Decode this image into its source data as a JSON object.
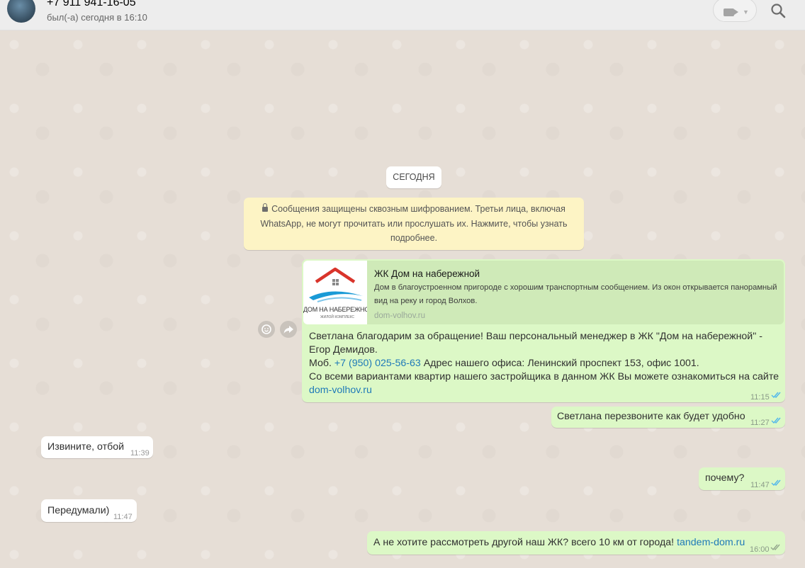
{
  "header": {
    "contact_name": "+7 911 941-16-05",
    "status": "был(-а) сегодня в 16:10",
    "icons": [
      "avatar",
      "video-call-icon",
      "chevron-down-icon",
      "search-icon"
    ]
  },
  "chat": {
    "date_label": "СЕГОДНЯ",
    "encryption_notice": "Сообщения защищены сквозным шифрованием. Третьи лица, включая WhatsApp, не могут прочитать или прослушать их. Нажмите, чтобы узнать подробнее.",
    "link_preview": {
      "title": "ЖК Дом на набережной",
      "description": "Дом в благоустроенном пригороде с хорошим транспортным сообщением. Из окон открывается панорамный вид на реку  и город Волхов.",
      "url": "dom-volhov.ru",
      "thumb_text": "ДОМ НА НАБЕРЕЖНОЙ",
      "thumb_subtext": "ЖИЛОЙ КОМПЛЕКС"
    },
    "messages": [
      {
        "direction": "out",
        "line1": "Светлана благодарим за обращение! Ваш персональный менеджер в ЖК \"Дом на набережной\" -",
        "line2": "Егор Демидов.",
        "line3_prefix": "Моб. ",
        "phone": "+7 (950) 025-56-63",
        "line3_suffix": " Адрес нашего офиса: Ленинский проспект 153, офис 1001.",
        "line4": "Со всеми вариантами квартир нашего застройщика в данном ЖК Вы можете ознакомиться на сайте",
        "link": "dom-volhov.ru",
        "time": "11:15",
        "status": "read"
      },
      {
        "direction": "out",
        "text": "Светлана перезвоните как будет удобно",
        "time": "11:27",
        "status": "read"
      },
      {
        "direction": "in",
        "text": "Извините, отбой",
        "time": "11:39"
      },
      {
        "direction": "out",
        "text": "почему?",
        "time": "11:47",
        "status": "read"
      },
      {
        "direction": "in",
        "text": "Передумали)",
        "time": "11:47"
      },
      {
        "direction": "out",
        "text_prefix": "А не хотите рассмотреть другой наш ЖК? всего 10 км от города! ",
        "link": "tandem-dom.ru",
        "time": "16:00",
        "status": "delivered"
      }
    ]
  },
  "colors": {
    "outgoing_bubble": "#dcf8c6",
    "incoming_bubble": "#ffffff",
    "link": "#1f7ab8",
    "read_ticks": "#4fb6ec",
    "delivered_ticks": "#92a58c",
    "notice_bg": "#fdf4c5"
  }
}
